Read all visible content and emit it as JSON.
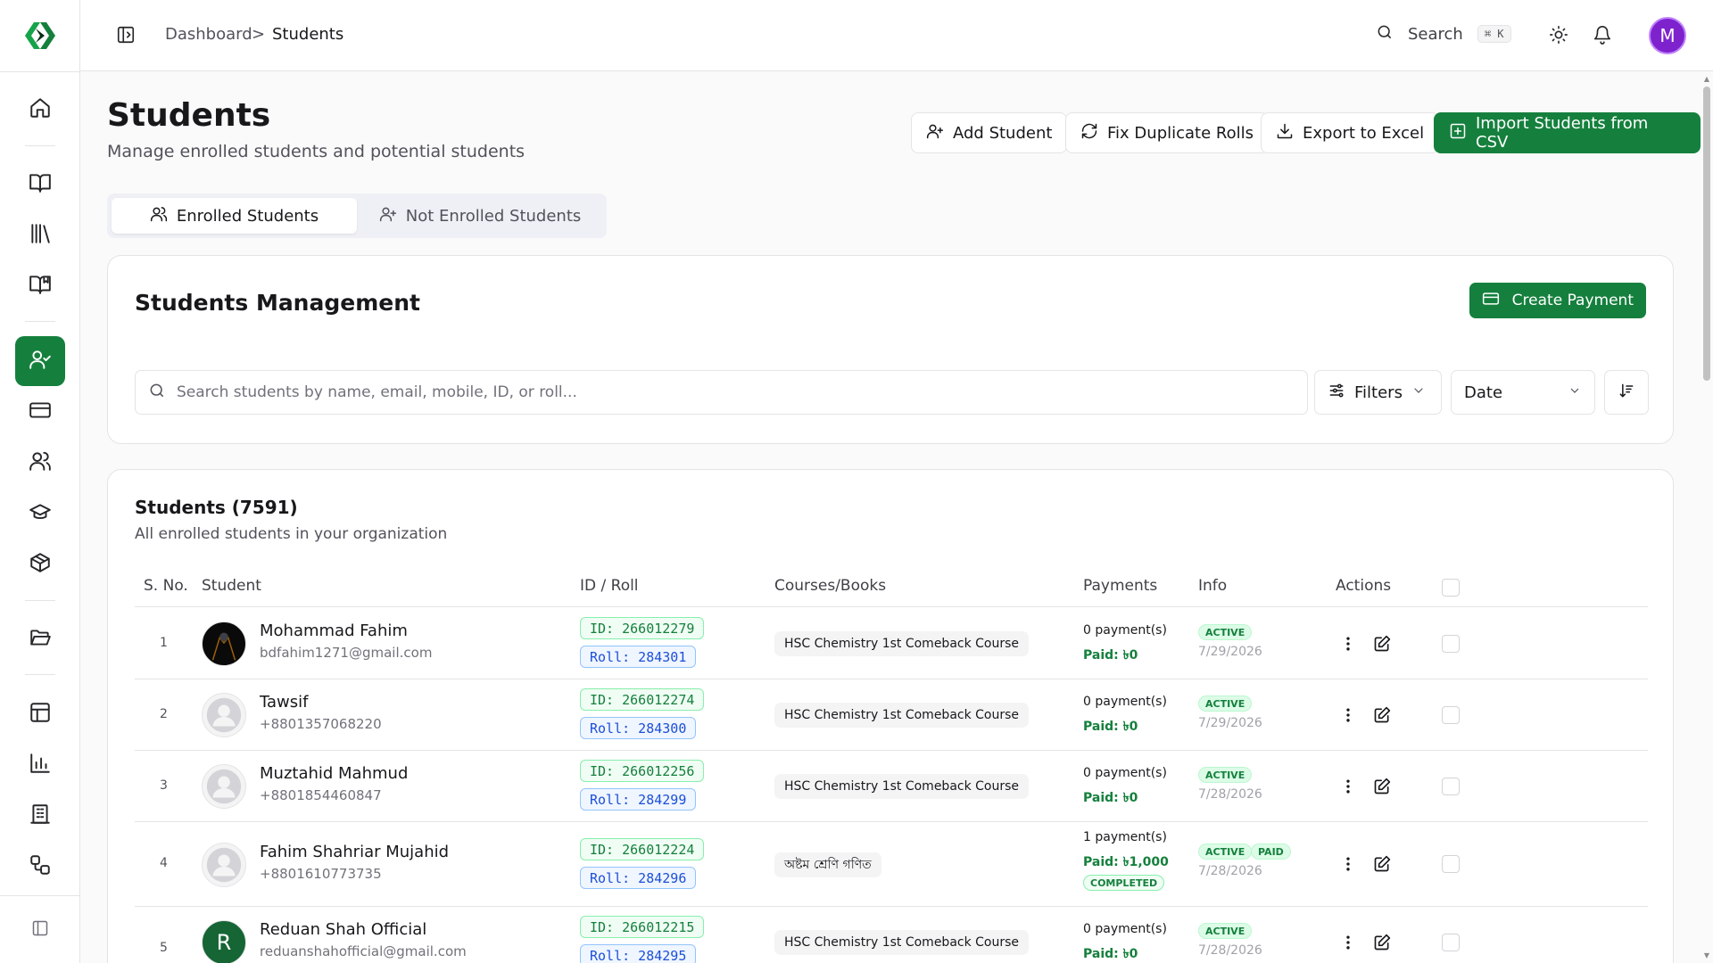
{
  "breadcrumb": {
    "root": "Dashboard",
    "separator": ">",
    "current": "Students"
  },
  "topbar": {
    "search_label": "Search",
    "search_shortcut": "⌘ K",
    "avatar_letter": "M"
  },
  "sidebar": {
    "items": [
      {
        "icon": "home-icon"
      },
      {
        "icon": "book-open-icon"
      },
      {
        "icon": "library-icon"
      },
      {
        "icon": "book-marked-icon"
      },
      {
        "icon": "user-check-icon",
        "active": true
      },
      {
        "icon": "credit-card-icon"
      },
      {
        "icon": "users-icon"
      },
      {
        "icon": "graduation-cap-icon"
      },
      {
        "icon": "package-icon"
      },
      {
        "icon": "folder-open-icon"
      },
      {
        "icon": "layout-icon"
      },
      {
        "icon": "bar-chart-icon"
      },
      {
        "icon": "building-icon"
      },
      {
        "icon": "workflow-icon"
      },
      {
        "icon": "panel-toggle-icon"
      }
    ]
  },
  "page": {
    "title": "Students",
    "subtitle": "Manage enrolled students and potential students",
    "buttons": {
      "add_student": "Add Student",
      "fix_duplicate": "Fix Duplicate Rolls",
      "export": "Export to Excel",
      "import": "Import Students from CSV"
    },
    "tabs": {
      "enrolled": "Enrolled Students",
      "not_enrolled": "Not Enrolled Students"
    }
  },
  "management": {
    "title": "Students Management",
    "create_payment": "Create Payment",
    "search_placeholder": "Search students by name, email, mobile, ID, or roll...",
    "filters_label": "Filters",
    "date_label": "Date"
  },
  "students_table": {
    "title": "Students (7591)",
    "subtitle": "All enrolled students in your organization",
    "headers": {
      "sno": "S. No.",
      "student": "Student",
      "id_roll": "ID / Roll",
      "courses": "Courses/Books",
      "payments": "Payments",
      "info": "Info",
      "actions": "Actions"
    },
    "rows": [
      {
        "sno": "1",
        "name": "Mohammad Fahim",
        "contact": "bdfahim1271@gmail.com",
        "id": "ID: 266012279",
        "roll": "Roll: 284301",
        "course": "HSC Chemistry 1st Comeback Course",
        "payments": "0 payment(s)",
        "paid": "Paid: ৳0",
        "status": "ACTIVE",
        "date": "7/29/2026"
      },
      {
        "sno": "2",
        "name": "Tawsif",
        "contact": "+8801357068220",
        "id": "ID: 266012274",
        "roll": "Roll: 284300",
        "course": "HSC Chemistry 1st Comeback Course",
        "payments": "0 payment(s)",
        "paid": "Paid: ৳0",
        "status": "ACTIVE",
        "date": "7/29/2026"
      },
      {
        "sno": "3",
        "name": "Muztahid Mahmud",
        "contact": "+8801854460847",
        "id": "ID: 266012256",
        "roll": "Roll: 284299",
        "course": "HSC Chemistry 1st Comeback Course",
        "payments": "0 payment(s)",
        "paid": "Paid: ৳0",
        "status": "ACTIVE",
        "date": "7/28/2026"
      },
      {
        "sno": "4",
        "name": "Fahim Shahriar Mujahid",
        "contact": "+8801610773735",
        "id": "ID: 266012224",
        "roll": "Roll: 284296",
        "course": "অষ্টম শ্রেণি গণিত",
        "payments": "1 payment(s)",
        "paid": "Paid: ৳1,000",
        "pay_status": "COMPLETED",
        "status": "ACTIVE",
        "status2": "PAID",
        "date": "7/28/2026"
      },
      {
        "sno": "5",
        "name": "Reduan Shah Official",
        "contact": "reduanshahofficial@gmail.com",
        "avatar_letter": "R",
        "id": "ID: 266012215",
        "roll": "Roll: 284295",
        "course": "HSC Chemistry 1st Comeback Course",
        "payments": "0 payment(s)",
        "paid": "Paid: ৳0",
        "status": "ACTIVE",
        "date": "7/28/2026"
      }
    ]
  }
}
